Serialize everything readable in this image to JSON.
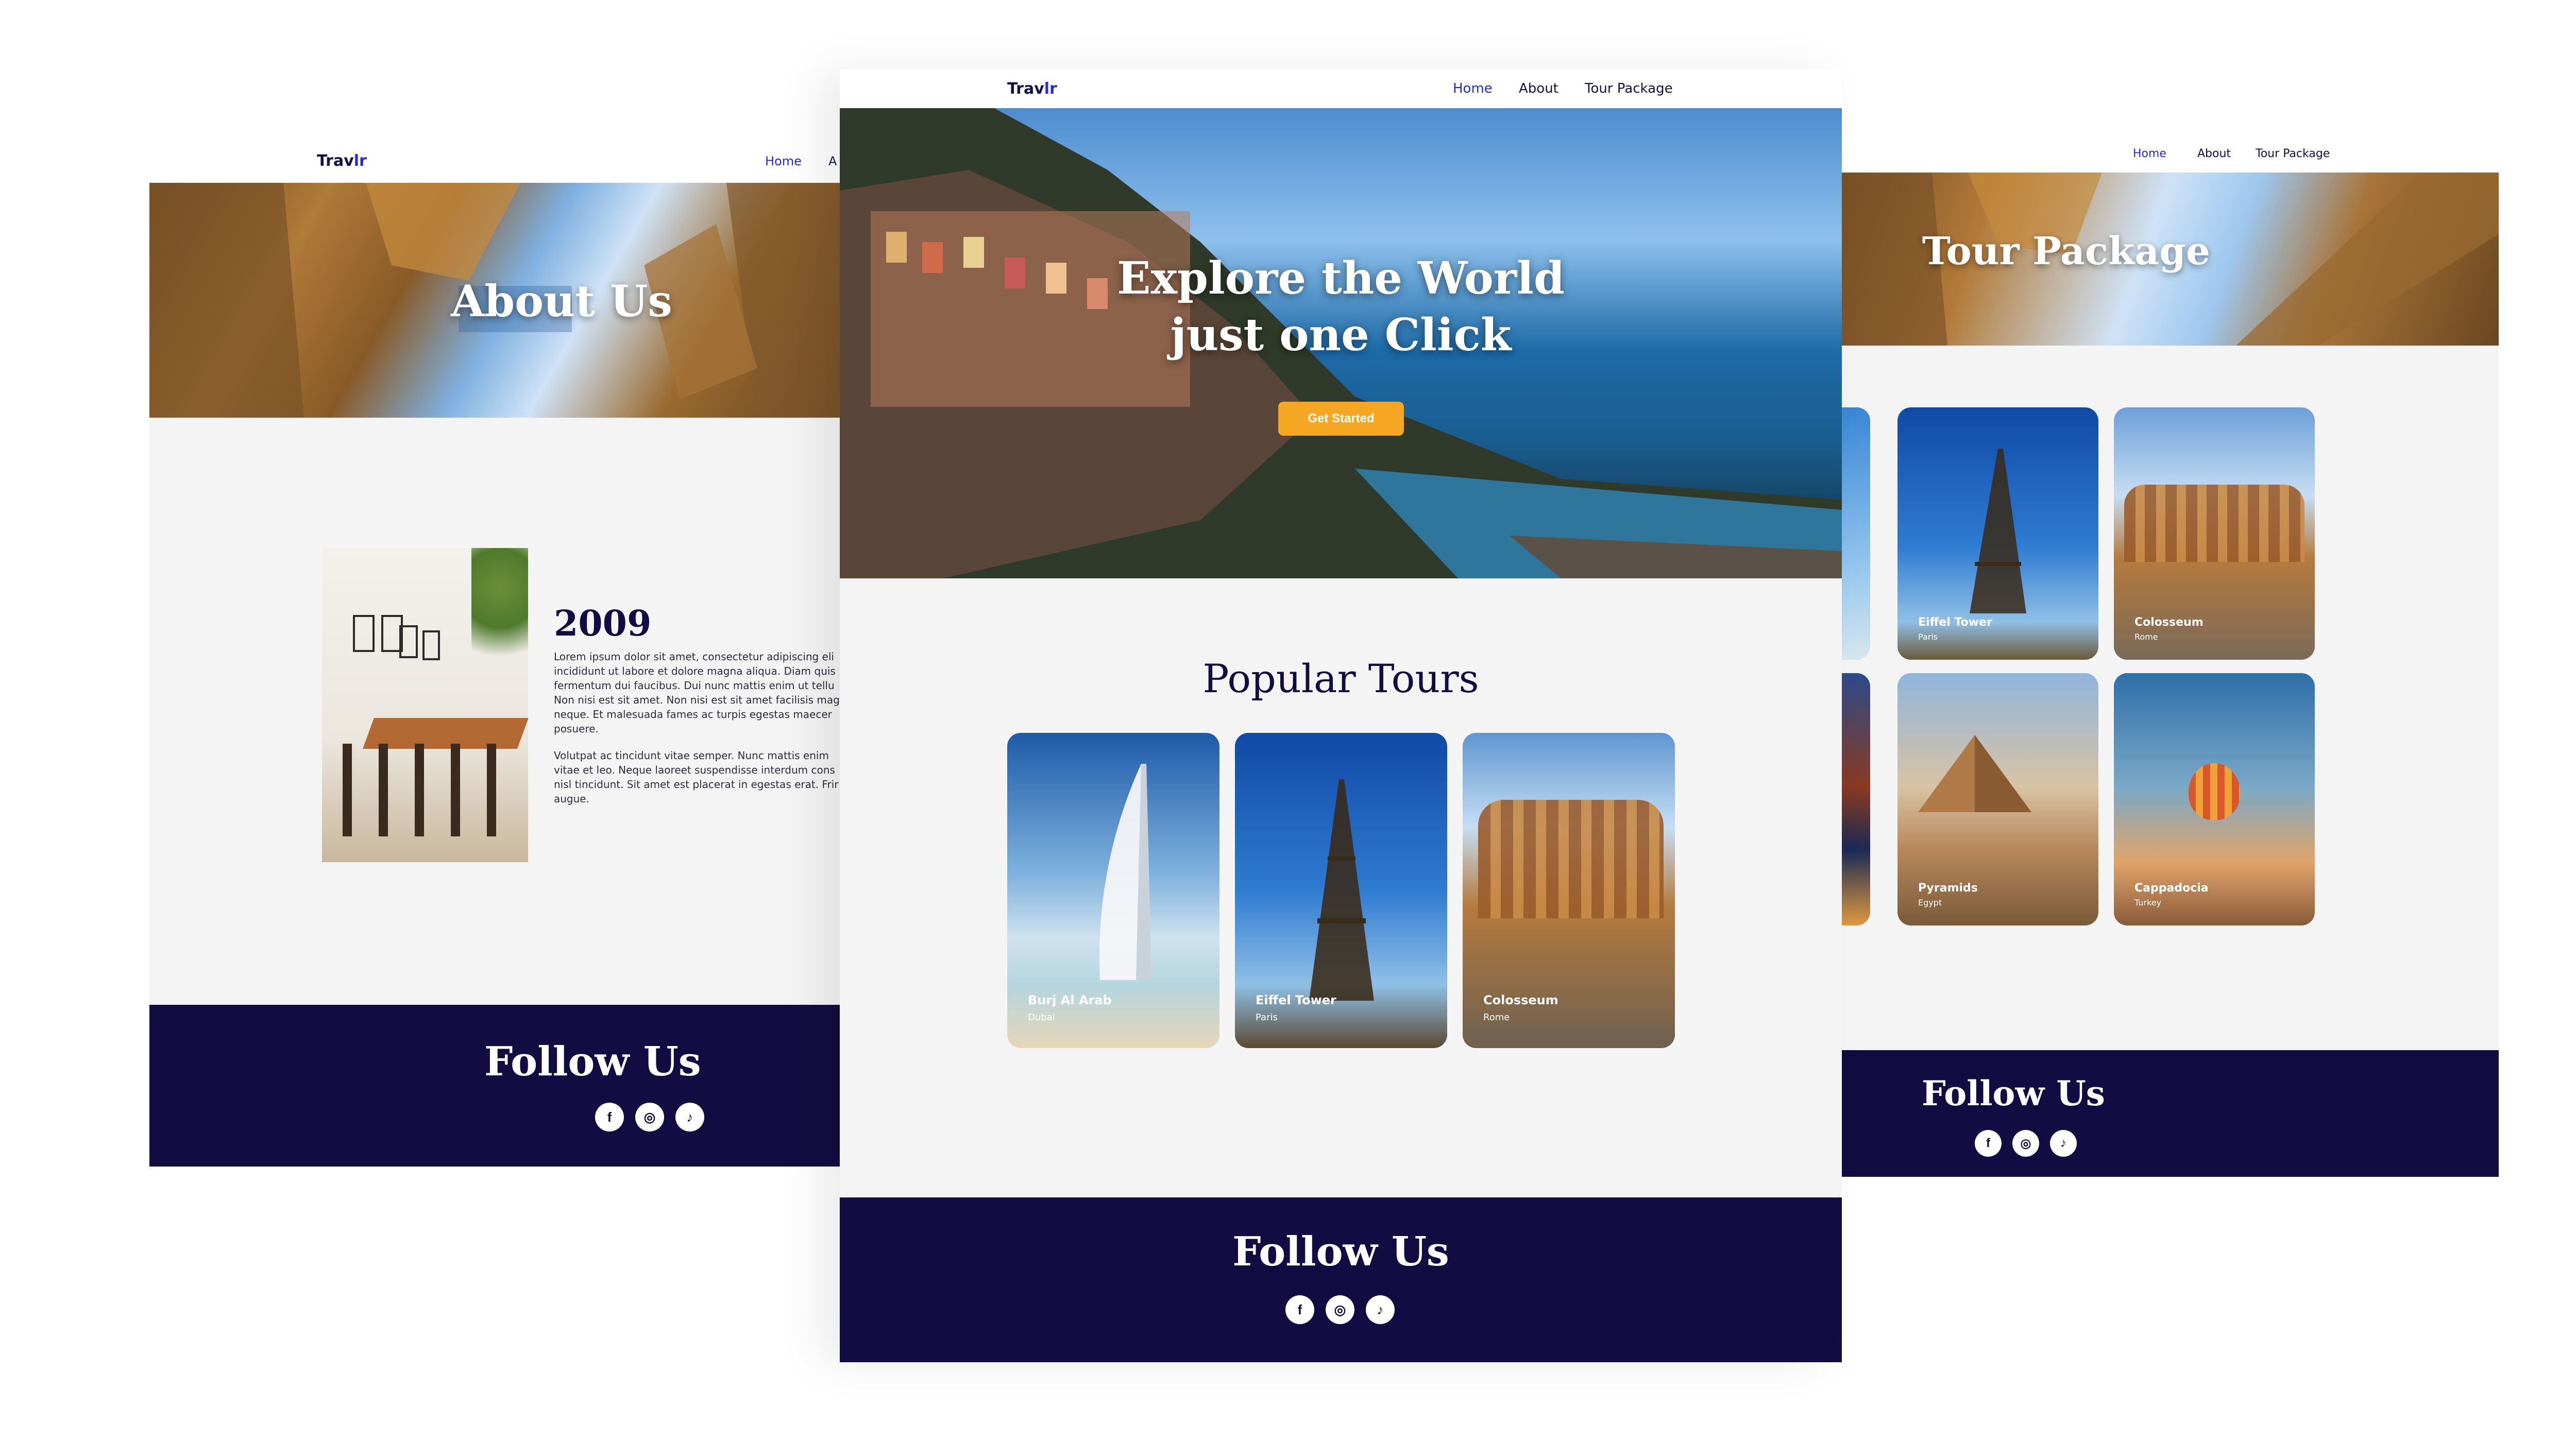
{
  "brand": {
    "logo_main": "Trav",
    "logo_accent": "lr"
  },
  "nav": {
    "home": "Home",
    "about": "About",
    "tour_package": "Tour Package"
  },
  "about_page": {
    "hero_title": "About Us",
    "year": "2009",
    "para1": "Lorem ipsum dolor sit amet, consectetur adipiscing eli incididunt ut labore et dolore magna aliqua. Diam quis fermentum dui faucibus. Dui nunc mattis enim ut tellu Non nisi est sit amet. Non nisi est sit amet facilisis mag neque. Et malesuada fames ac turpis egestas maecer posuere.",
    "para2": "Volutpat ac tincidunt vitae semper. Nunc mattis enim vitae et leo. Neque laoreet suspendisse interdum cons nisl tincidunt. Sit amet est placerat in egestas erat. Frir augue.",
    "footer_title": "Follow Us"
  },
  "home_page": {
    "hero_line1": "Explore the World",
    "hero_line2": "just one Click",
    "cta": "Get Started",
    "section_title": "Popular Tours",
    "tours": [
      {
        "name": "Burj Al Arab",
        "city": "Dubai"
      },
      {
        "name": "Eiffel Tower",
        "city": "Paris"
      },
      {
        "name": "Colosseum",
        "city": "Rome"
      }
    ],
    "footer_title": "Follow Us"
  },
  "tour_page": {
    "hero_title": "Tour Package",
    "tours": [
      {
        "name": "Eiffel Tower",
        "city": "Paris"
      },
      {
        "name": "Colosseum",
        "city": "Rome"
      },
      {
        "name": "Pyramids",
        "city": "Egypt"
      },
      {
        "name": "Cappadocia",
        "city": "Turkey"
      }
    ],
    "footer_title": "Follow Us"
  },
  "social": {
    "facebook": "f",
    "instagram": "◎",
    "tiktok": "♪"
  },
  "colors": {
    "navy": "#110d42",
    "accent_orange": "#f5a623",
    "link_blue": "#1f2bd6",
    "bg_grey": "#f4f4f4"
  }
}
